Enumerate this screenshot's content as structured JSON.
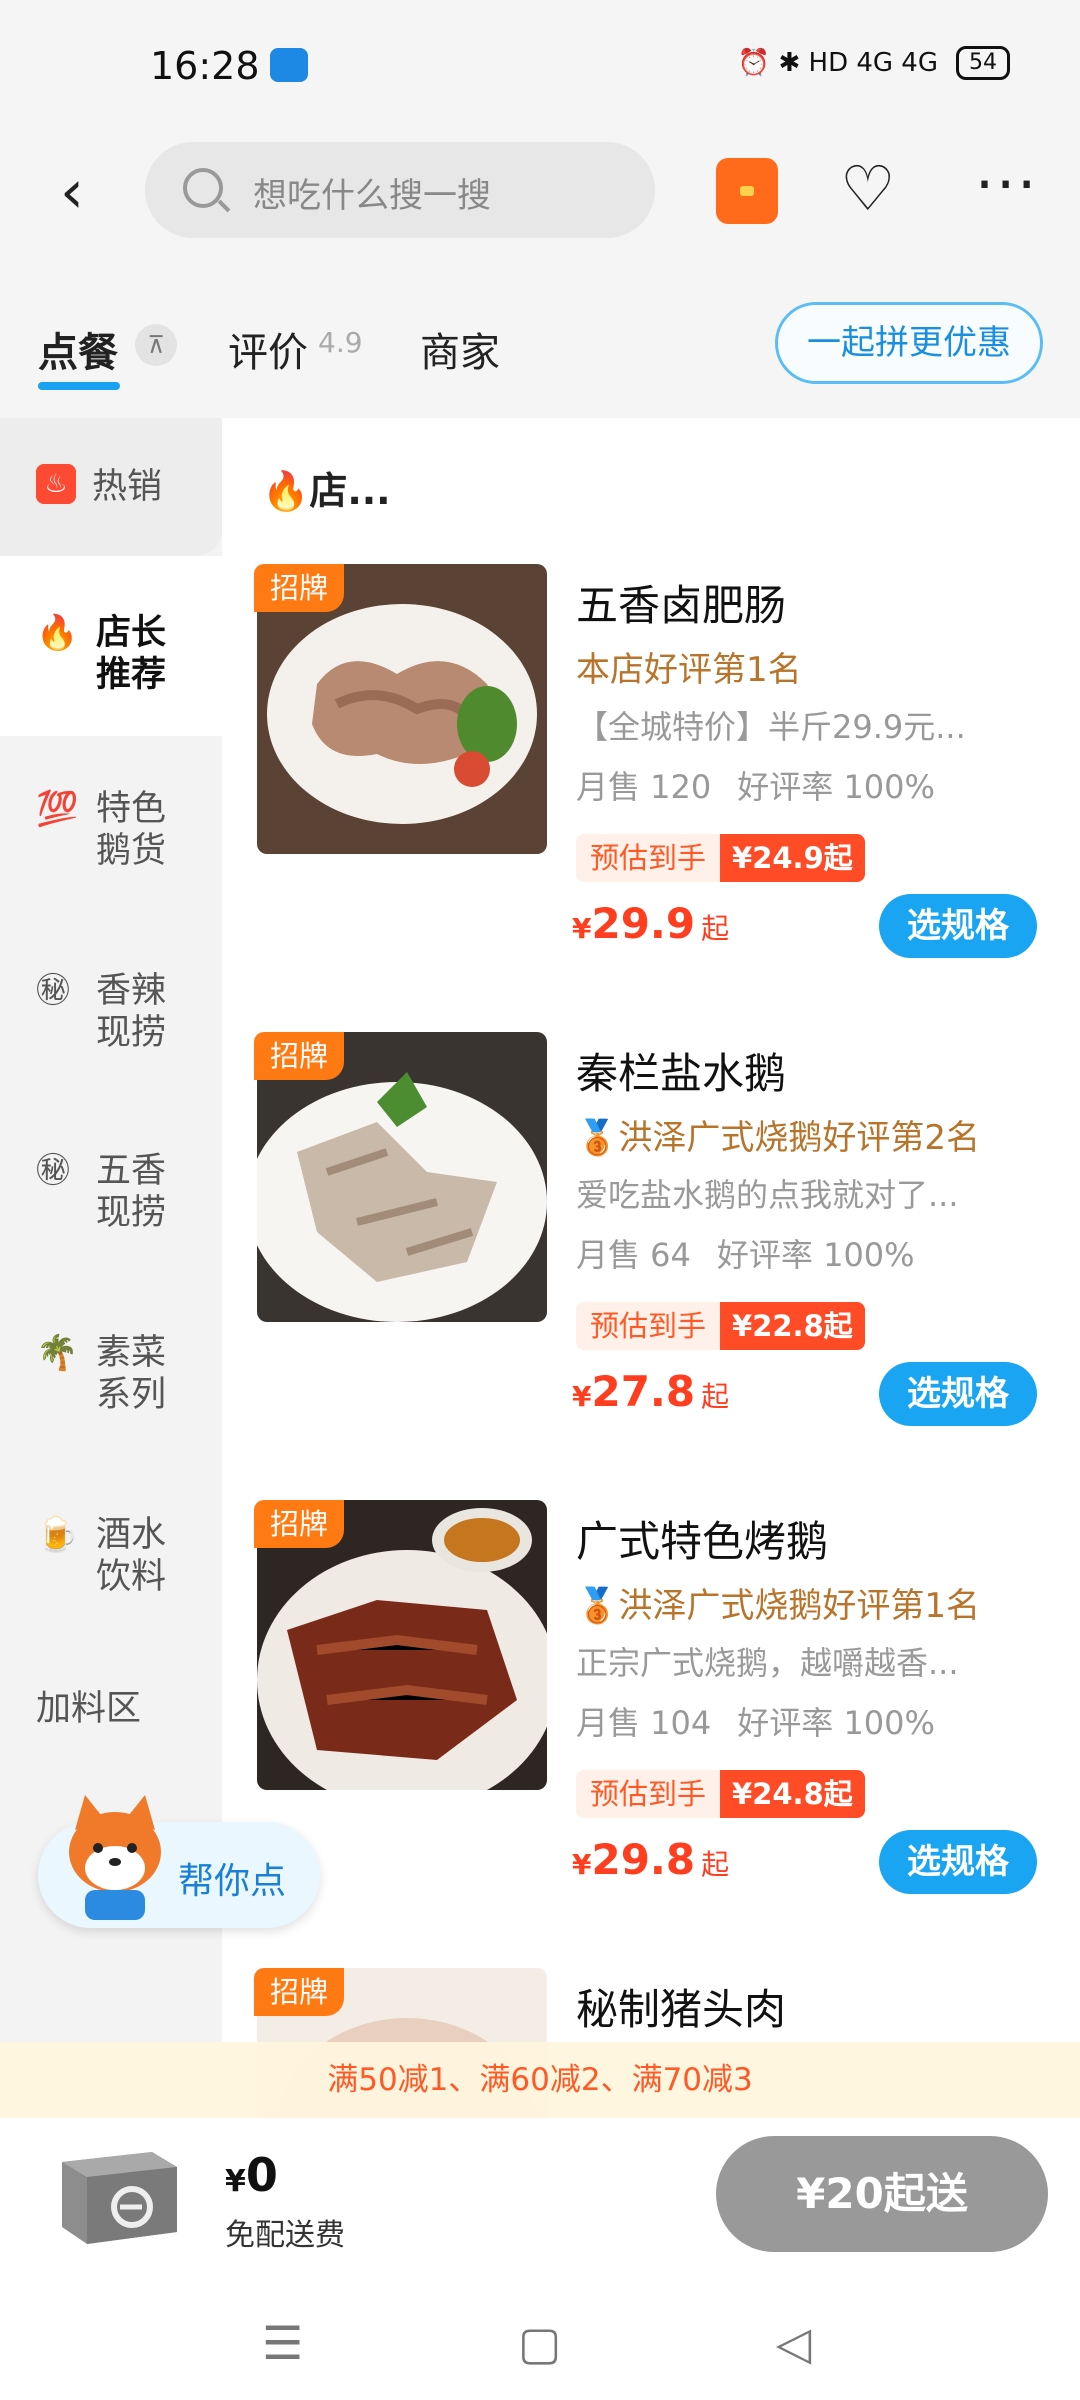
{
  "status_bar": {
    "time": "16:28",
    "right_text": "⏰ ✱ HD 4G 4G",
    "battery": "54"
  },
  "nav": {
    "search_placeholder": "想吃什么搜一搜"
  },
  "tabs": {
    "order": "点餐",
    "pin_icon": "⊼",
    "reviews": "评价",
    "rating": "4.9",
    "merchant": "商家",
    "group_button": "一起拼更优惠"
  },
  "sidebar": {
    "items": [
      {
        "icon": "flame-icon",
        "label": "热销"
      },
      {
        "icon": "🔥",
        "label_lines": [
          "店长",
          "推荐"
        ]
      },
      {
        "icon": "💯",
        "label_lines": [
          "特色",
          "鹅货"
        ]
      },
      {
        "icon": "㊙",
        "label_lines": [
          "香辣",
          "现捞"
        ]
      },
      {
        "icon": "㊙",
        "label_lines": [
          "五香",
          "现捞"
        ]
      },
      {
        "icon": "🌴",
        "label_lines": [
          "素菜",
          "系列"
        ]
      },
      {
        "icon": "🍺",
        "label_lines": [
          "酒水",
          "饮料"
        ]
      },
      {
        "label": "加料区"
      }
    ]
  },
  "section_title": "🔥店...",
  "products": [
    {
      "badge": "招牌",
      "name": "五香卤肥肠",
      "rank": "本店好评第1名",
      "desc": "【全城特价】半斤29.9元...",
      "sales": "月售 120",
      "rate": "好评率 100%",
      "est_label": "预估到手",
      "est_price": "¥24.9起",
      "price_symbol": "¥",
      "price": "29.9",
      "price_suffix": "起",
      "button": "选规格"
    },
    {
      "badge": "招牌",
      "name": "秦栏盐水鹅",
      "rank": "🥉洪泽广式烧鹅好评第2名",
      "desc": "爱吃盐水鹅的点我就对了...",
      "sales": "月售 64",
      "rate": "好评率 100%",
      "est_label": "预估到手",
      "est_price": "¥22.8起",
      "price_symbol": "¥",
      "price": "27.8",
      "price_suffix": "起",
      "button": "选规格"
    },
    {
      "badge": "招牌",
      "name": "广式特色烤鹅",
      "rank": "🥉洪泽广式烧鹅好评第1名",
      "desc": "正宗广式烧鹅，越嚼越香...",
      "sales": "月售 104",
      "rate": "好评率 100%",
      "est_label": "预估到手",
      "est_price": "¥24.8起",
      "price_symbol": "¥",
      "price": "29.8",
      "price_suffix": "起",
      "button": "选规格"
    },
    {
      "badge": "招牌",
      "name": "秘制猪头肉"
    }
  ],
  "helper": {
    "label": "帮你点"
  },
  "promo": {
    "text": "满50减1、满60减2、满70减3"
  },
  "bottom": {
    "amount_symbol": "¥",
    "amount": "0",
    "fee": "免配送费",
    "checkout": "¥20起送"
  },
  "colors": {
    "accent_blue": "#1aa5f2",
    "price_red": "#ff3d1f",
    "badge_orange": "#ff7a12",
    "rank_gold": "#b8742a"
  }
}
